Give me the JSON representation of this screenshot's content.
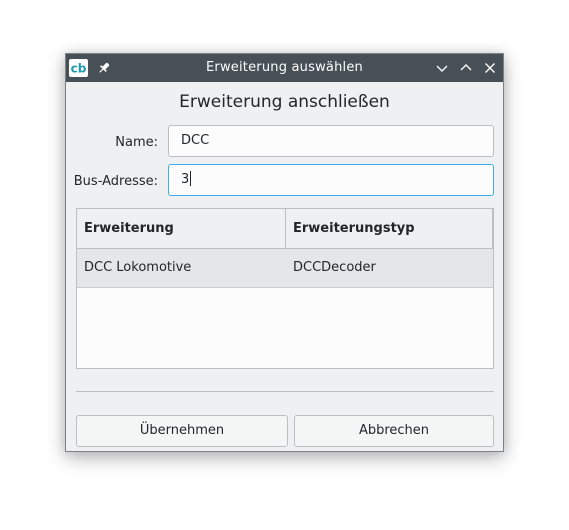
{
  "window": {
    "title": "Erweiterung auswählen",
    "app_icon_text": "cb"
  },
  "dialog": {
    "heading": "Erweiterung anschließen",
    "name_label": "Name:",
    "name_value": "DCC",
    "bus_label": "Bus-Adresse:",
    "bus_value": "3"
  },
  "table": {
    "columns": [
      "Erweiterung",
      "Erweiterungstyp"
    ],
    "rows": [
      [
        "DCC Lokomotive",
        "DCCDecoder"
      ]
    ]
  },
  "buttons": {
    "ok_label": "Übernehmen",
    "cancel_label": "Abbrechen"
  },
  "colors": {
    "titlebar": "#475057",
    "focus": "#3daee9",
    "selected_row": "#e3e7ea",
    "app_icon": "#1d99b0"
  }
}
